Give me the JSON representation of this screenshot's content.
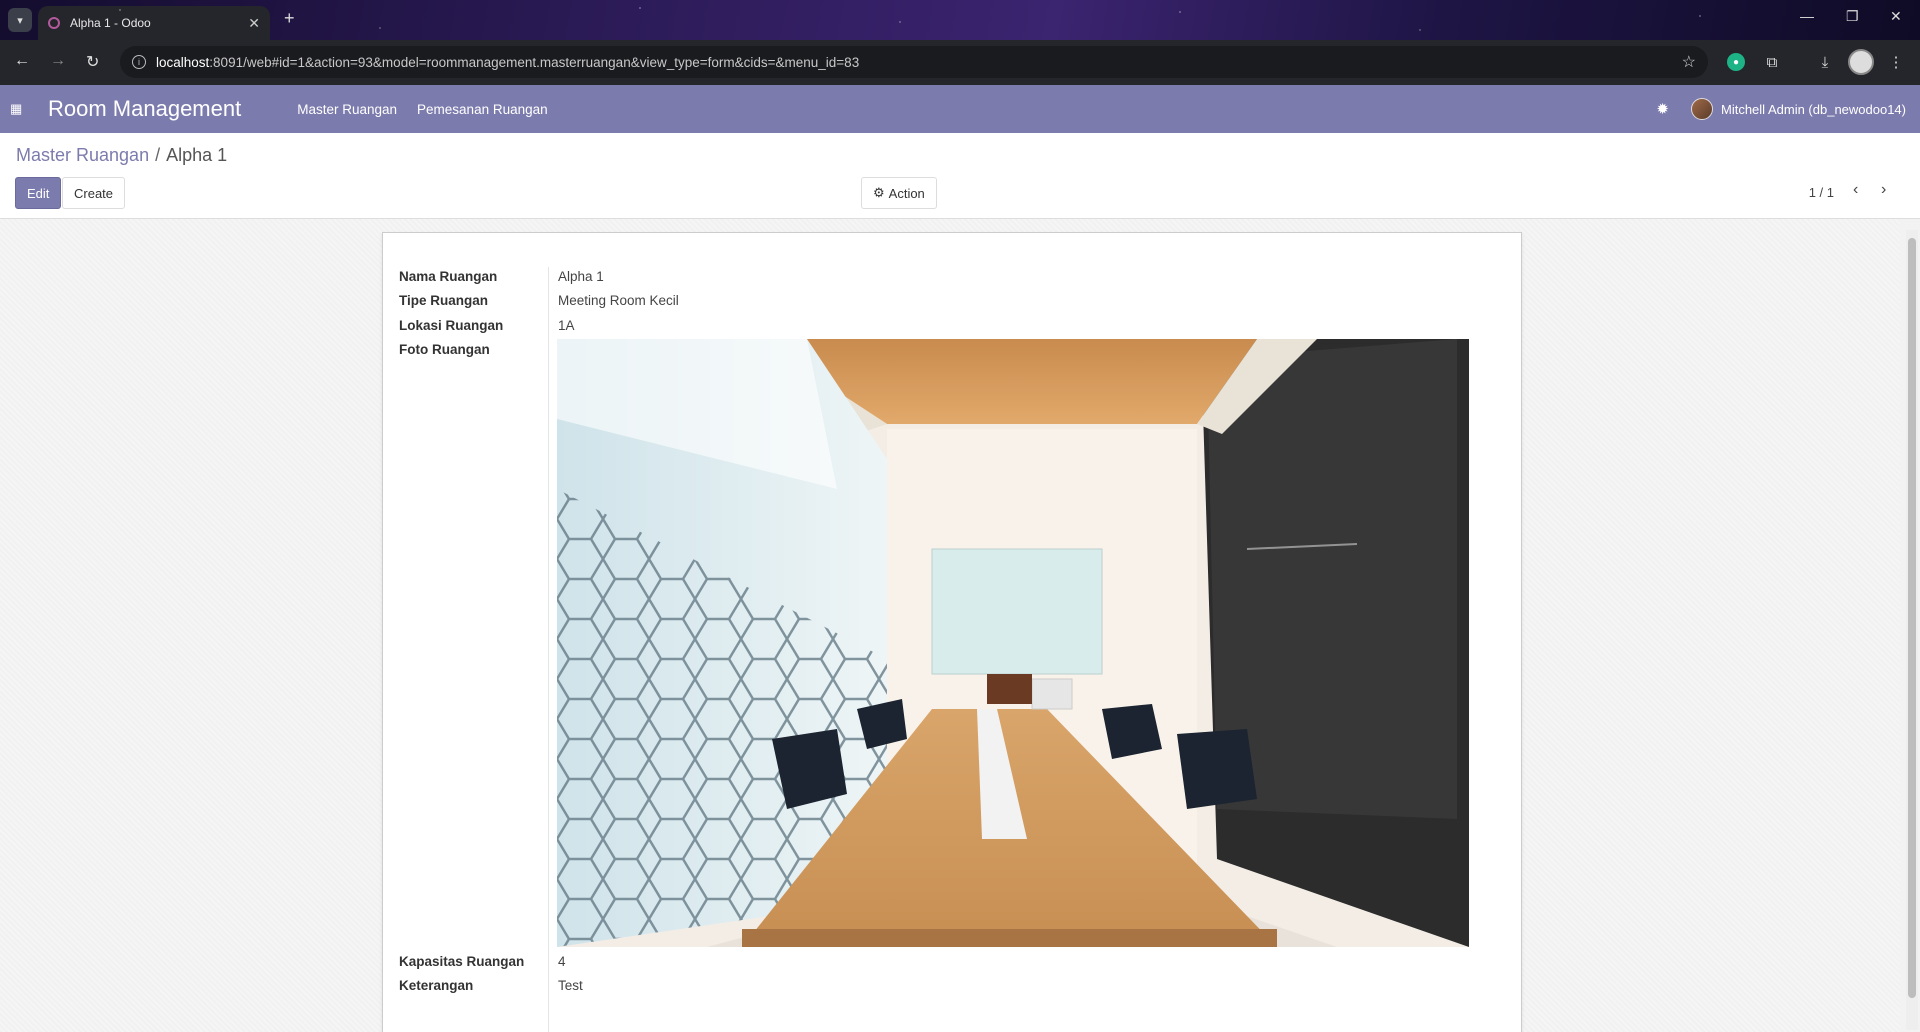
{
  "browser": {
    "tab_title": "Alpha 1 - Odoo",
    "url_host": "localhost",
    "url_rest": ":8091/web#id=1&action=93&model=roommanagement.masterruangan&view_type=form&cids=&menu_id=83"
  },
  "navbar": {
    "brand": "Room Management",
    "menu": [
      "Master Ruangan",
      "Pemesanan Ruangan"
    ],
    "user": "Mitchell Admin (db_newodoo14)"
  },
  "control_panel": {
    "breadcrumb_parent": "Master Ruangan",
    "breadcrumb_separator": "/",
    "breadcrumb_current": "Alpha 1",
    "edit_label": "Edit",
    "create_label": "Create",
    "action_label": "Action",
    "pager": "1 / 1"
  },
  "form": {
    "fields": [
      {
        "label": "Nama Ruangan",
        "value": "Alpha 1"
      },
      {
        "label": "Tipe Ruangan",
        "value": "Meeting Room Kecil"
      },
      {
        "label": "Lokasi Ruangan",
        "value": "1A"
      },
      {
        "label": "Foto Ruangan",
        "value": ""
      },
      {
        "label": "Kapasitas Ruangan",
        "value": "4"
      },
      {
        "label": "Keterangan",
        "value": "Test"
      }
    ]
  },
  "colors": {
    "brand": "#7c7bad"
  }
}
